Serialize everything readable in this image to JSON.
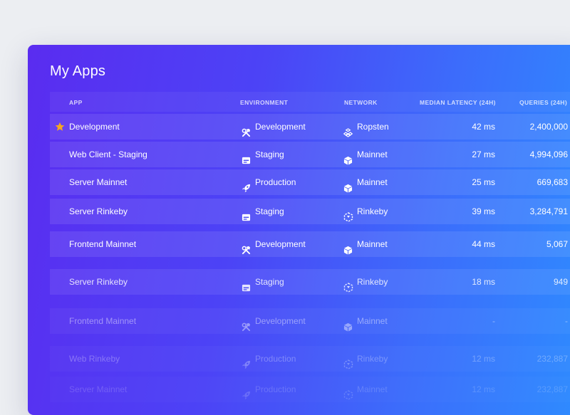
{
  "page_title": "My Apps",
  "columns": {
    "app": "APP",
    "environment": "ENVIRONMENT",
    "network": "NETWORK",
    "latency": "MEDIAN LATENCY (24H)",
    "queries": "QUERIES (24H)"
  },
  "colors": {
    "star": "#f5a623",
    "background": "#eceef2"
  },
  "rows": [
    {
      "starred": true,
      "app": "Development",
      "env": "Development",
      "env_icon": "hammer-wrench-icon",
      "network": "Ropsten",
      "net_icon": "ropsten-icon",
      "latency": "42 ms",
      "queries": "2,400,000",
      "opacity": 1
    },
    {
      "starred": false,
      "app": "Web Client - Staging",
      "env": "Staging",
      "env_icon": "staging-server-icon",
      "network": "Mainnet",
      "net_icon": "cube-icon",
      "latency": "27 ms",
      "queries": "4,994,096",
      "opacity": 1
    },
    {
      "starred": false,
      "app": "Server Mainnet",
      "env": "Production",
      "env_icon": "rocket-icon",
      "network": "Mainnet",
      "net_icon": "cube-icon",
      "latency": "25 ms",
      "queries": "669,683",
      "opacity": 1
    },
    {
      "starred": false,
      "app": "Server Rinkeby",
      "env": "Staging",
      "env_icon": "staging-server-icon",
      "network": "Rinkeby",
      "net_icon": "rinkeby-icon",
      "latency": "39 ms",
      "queries": "3,284,791",
      "opacity": 1
    },
    {
      "starred": false,
      "app": "Frontend Mainnet",
      "env": "Development",
      "env_icon": "hammer-wrench-icon",
      "network": "Mainnet",
      "net_icon": "cube-icon",
      "latency": "44 ms",
      "queries": "5,067",
      "opacity": 1
    },
    {
      "starred": false,
      "app": "Server Rinkeby",
      "env": "Staging",
      "env_icon": "staging-server-icon",
      "network": "Rinkeby",
      "net_icon": "rinkeby-icon",
      "latency": "18 ms",
      "queries": "949",
      "opacity": 0.85
    },
    {
      "starred": false,
      "app": "Frontend Mainnet",
      "env": "Development",
      "env_icon": "hammer-wrench-icon",
      "network": "Mainnet",
      "net_icon": "cube-icon",
      "latency": "-",
      "queries": "-",
      "opacity": 0.45
    },
    {
      "starred": false,
      "app": "Web Rinkeby",
      "env": "Production",
      "env_icon": "rocket-icon",
      "network": "Rinkeby",
      "net_icon": "rinkeby-icon",
      "latency": "12 ms",
      "queries": "232,887",
      "opacity": 0.3
    },
    {
      "starred": false,
      "app": "Server Mainnet",
      "env": "Production",
      "env_icon": "rocket-icon",
      "network": "Mainnet",
      "net_icon": "rinkeby-icon",
      "latency": "12 ms",
      "queries": "232,887",
      "opacity": 0.18
    }
  ]
}
